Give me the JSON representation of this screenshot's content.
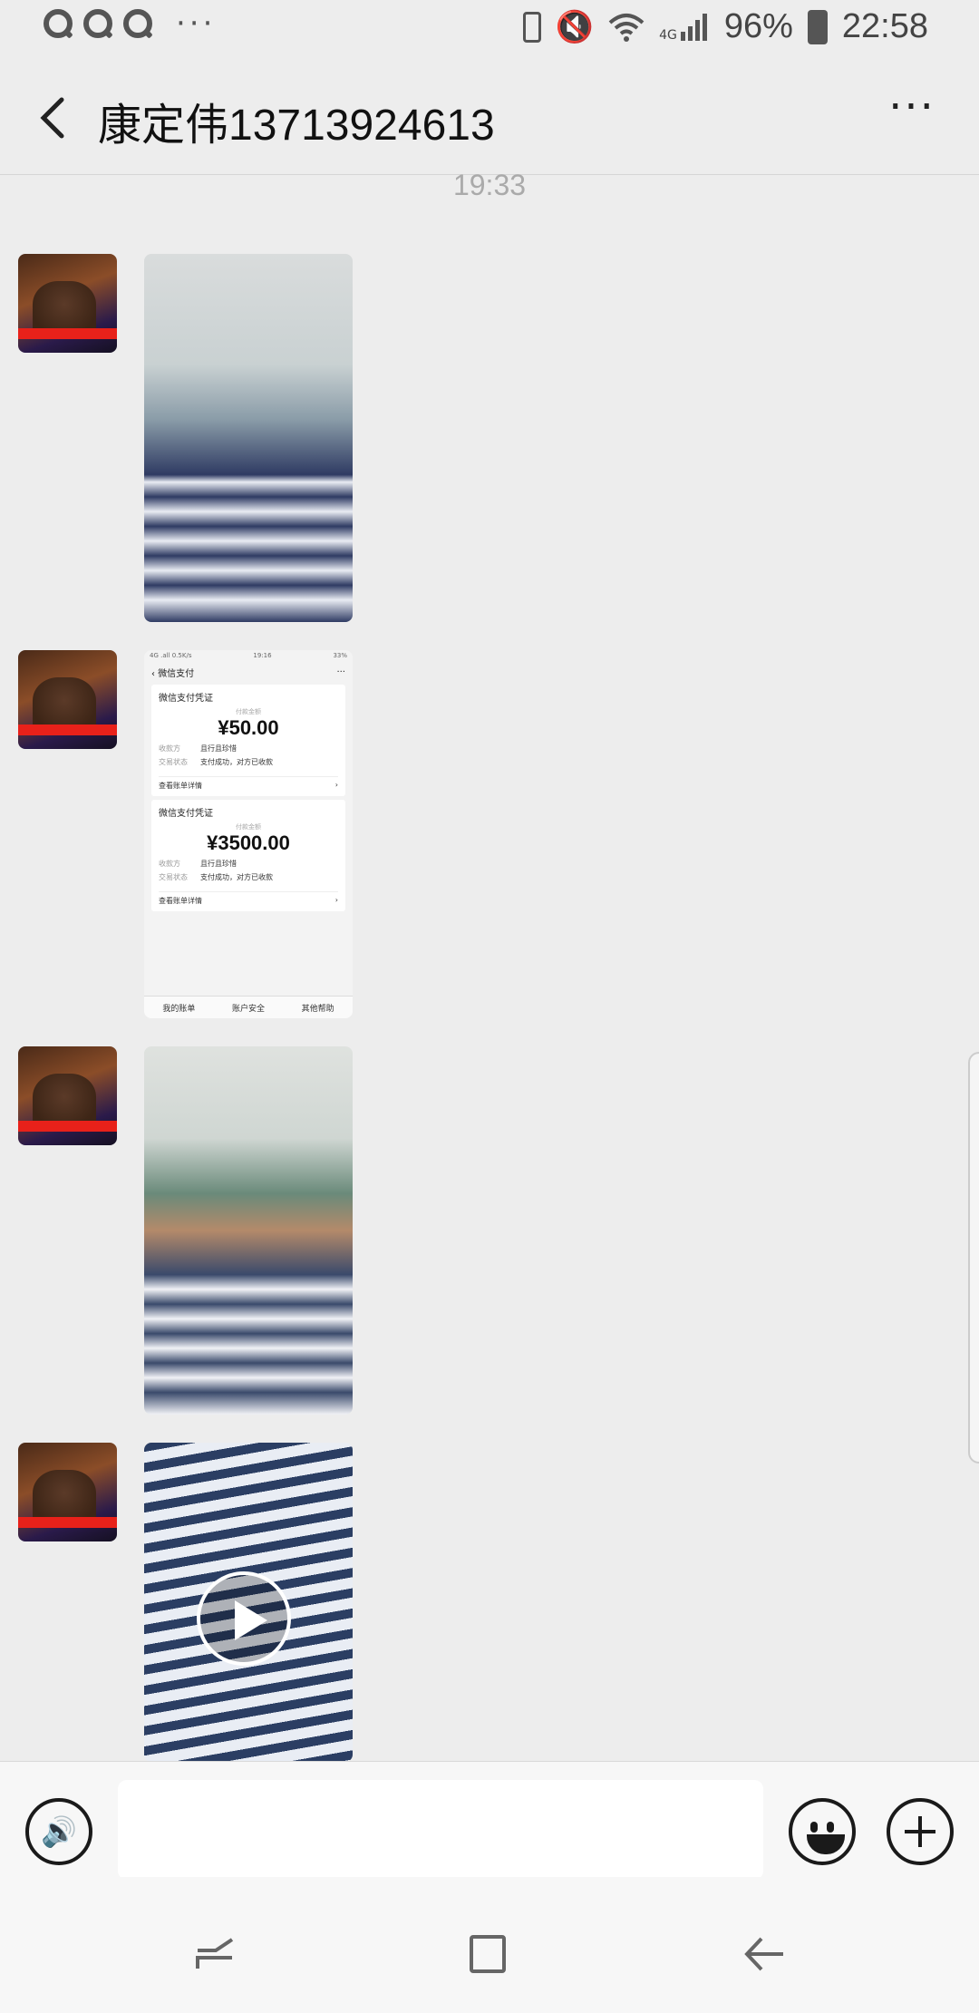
{
  "status_bar": {
    "battery_percent": "96%",
    "time": "22:58",
    "network": "4G"
  },
  "header": {
    "title": "康定伟13713924613"
  },
  "chat": {
    "timestamp": "19:33",
    "messages": [
      {
        "type": "image",
        "content": "hospital-ward-photo"
      },
      {
        "type": "image",
        "content": "payment-receipt-screenshot"
      },
      {
        "type": "image",
        "content": "hospital-ward-photo"
      },
      {
        "type": "video",
        "content": "hospital-bed-video"
      }
    ]
  },
  "payment_screenshot": {
    "status_left": "4G .all 0.5K/s",
    "status_time": "19:16",
    "status_right": "33%",
    "app_title": "微信支付",
    "cards": [
      {
        "title": "微信支付凭证",
        "amount_label": "付款金额",
        "amount": "¥50.00",
        "payee_label": "收款方",
        "payee": "且行且珍惜",
        "state_label": "交易状态",
        "state": "支付成功，对方已收款",
        "detail": "查看账单详情"
      },
      {
        "title": "微信支付凭证",
        "amount_label": "付款金额",
        "amount": "¥3500.00",
        "payee_label": "收款方",
        "payee": "且行且珍惜",
        "state_label": "交易状态",
        "state": "支付成功，对方已收款",
        "detail": "查看账单详情"
      }
    ],
    "footer": [
      "我的账单",
      "账户安全",
      "其他帮助"
    ]
  },
  "input": {
    "placeholder": ""
  }
}
